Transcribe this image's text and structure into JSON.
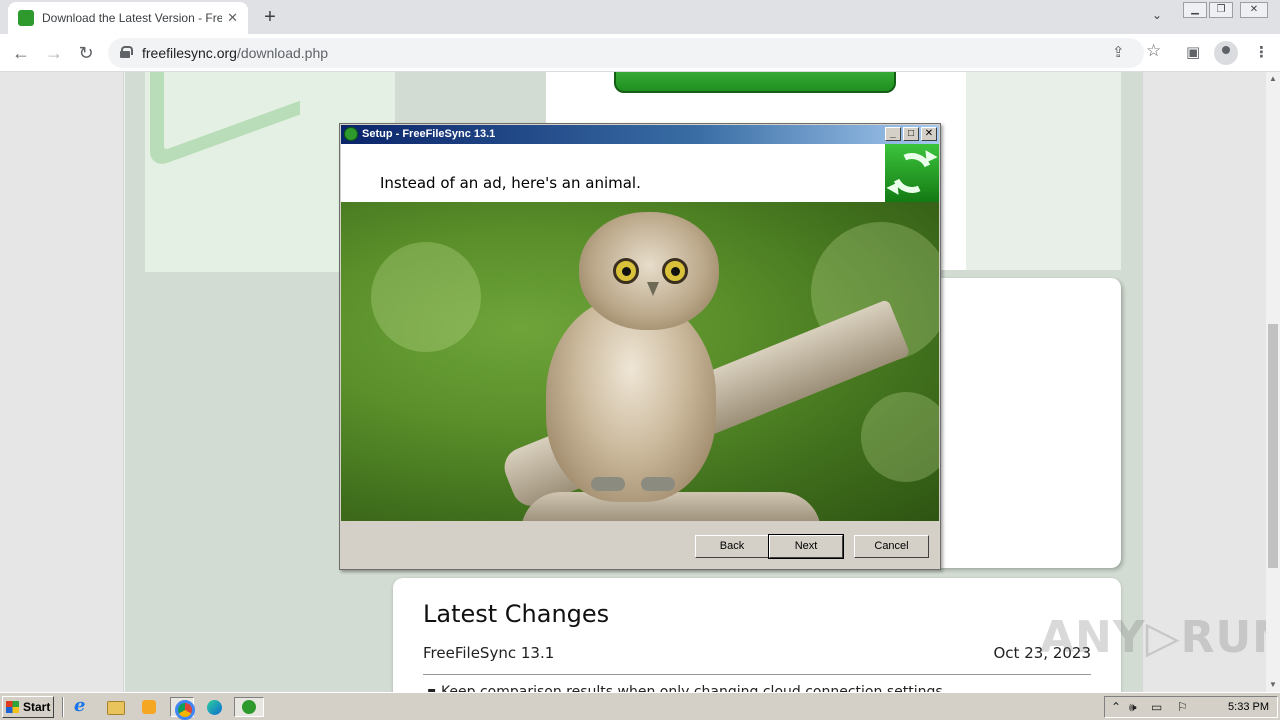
{
  "browser": {
    "tab_title": "Download the Latest Version - FreeFileSync",
    "tab_close": "✕",
    "new_tab": "+",
    "url_host": "freefilesync.org",
    "url_path": "/download.php"
  },
  "page": {
    "changes_title": "Latest Changes",
    "changes_version": "FreeFileSync 13.1",
    "changes_date": "Oct 23, 2023",
    "changes_item": "▪ Keep comparison results when only changing cloud connection settings",
    "watermark": "ANY▷RUN"
  },
  "dialog": {
    "title": "Setup - FreeFileSync 13.1",
    "header_text": "Instead of an ad, here's an animal.",
    "buttons": {
      "back": "Back",
      "next": "Next",
      "cancel": "Cancel"
    }
  },
  "taskbar": {
    "start_label": "Start",
    "clock": "5:33 PM"
  },
  "colors": {
    "dialog_title_gradient_start": "#0a246a",
    "freefilesync_green": "#2e9a2e",
    "system_face": "#d4d0c8"
  },
  "icons": {
    "tab_favicon": "freefilesync-icon",
    "lock": "lock-icon",
    "share": "share-icon",
    "bookmark": "star-icon",
    "side_panel": "side-panel-icon",
    "profile": "profile-icon",
    "menu": "kebab-menu-icon"
  }
}
